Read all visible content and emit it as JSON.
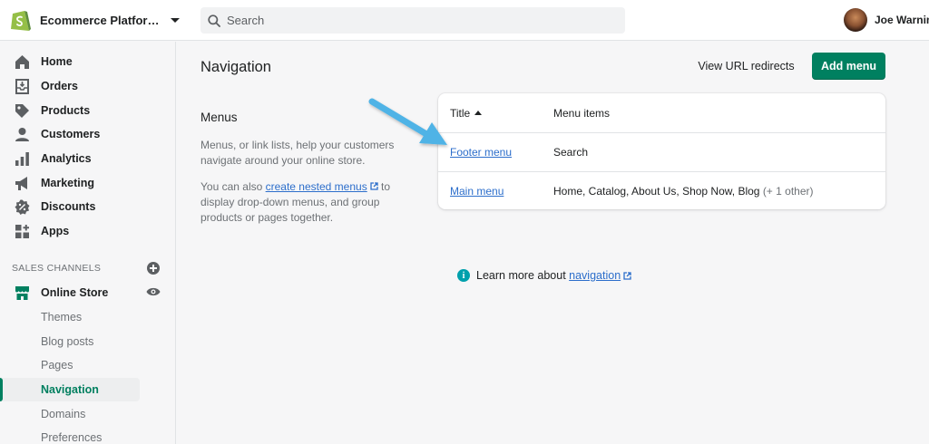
{
  "topbar": {
    "store_name": "Ecommerce Platfor…",
    "search_placeholder": "Search",
    "user_name": "Joe Warnim"
  },
  "sidebar": {
    "items": [
      {
        "label": "Home",
        "icon": "home-icon"
      },
      {
        "label": "Orders",
        "icon": "orders-icon"
      },
      {
        "label": "Products",
        "icon": "tag-icon"
      },
      {
        "label": "Customers",
        "icon": "person-icon"
      },
      {
        "label": "Analytics",
        "icon": "bar-chart-icon"
      },
      {
        "label": "Marketing",
        "icon": "megaphone-icon"
      },
      {
        "label": "Discounts",
        "icon": "discount-icon"
      },
      {
        "label": "Apps",
        "icon": "apps-icon"
      }
    ],
    "sales_channels_label": "SALES CHANNELS",
    "online_store": {
      "label": "Online Store",
      "icon": "store-icon"
    },
    "subitems": [
      {
        "label": "Themes"
      },
      {
        "label": "Blog posts"
      },
      {
        "label": "Pages"
      },
      {
        "label": "Navigation",
        "active": true
      },
      {
        "label": "Domains"
      },
      {
        "label": "Preferences"
      }
    ]
  },
  "main": {
    "title": "Navigation",
    "view_redirects_label": "View URL redirects",
    "add_menu_label": "Add menu",
    "menus_heading": "Menus",
    "menus_description": "Menus, or link lists, help your customers navigate around your online store.",
    "nested_prefix": "You can also ",
    "nested_link": "create nested menus",
    "nested_suffix": " to display drop-down menus, and group products or pages together.",
    "table": {
      "headers": {
        "title": "Title",
        "menu_items": "Menu items"
      },
      "rows": [
        {
          "title": "Footer menu",
          "items": "Search",
          "extra": ""
        },
        {
          "title": "Main menu",
          "items": "Home, Catalog, About Us, Shop Now, Blog",
          "extra": "(+ 1 other)"
        }
      ]
    },
    "learn_more_text": "Learn more about ",
    "learn_more_link": "navigation"
  },
  "colors": {
    "primary": "#008060",
    "link": "#2c6ecb",
    "annotation_arrow": "#4fb3e6",
    "info": "#00a0ac"
  }
}
